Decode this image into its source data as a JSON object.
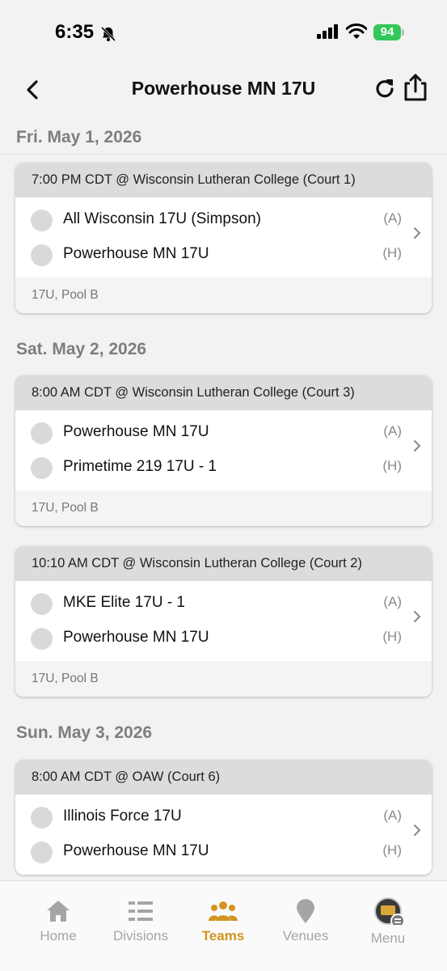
{
  "status": {
    "time": "6:35",
    "battery": "94"
  },
  "nav": {
    "title": "Powerhouse MN 17U"
  },
  "days": [
    {
      "label": "Fri. May 1, 2026",
      "games": [
        {
          "header": "7:00 PM CDT @ Wisconsin Lutheran College (Court 1)",
          "teams": [
            {
              "name": "All Wisconsin 17U (Simpson)",
              "side": "(A)"
            },
            {
              "name": "Powerhouse MN 17U",
              "side": "(H)"
            }
          ],
          "footer": "17U, Pool B"
        }
      ]
    },
    {
      "label": "Sat. May 2, 2026",
      "games": [
        {
          "header": "8:00 AM CDT @ Wisconsin Lutheran College (Court 3)",
          "teams": [
            {
              "name": "Powerhouse MN 17U",
              "side": "(A)"
            },
            {
              "name": "Primetime 219 17U - 1",
              "side": "(H)"
            }
          ],
          "footer": "17U, Pool B"
        },
        {
          "header": "10:10 AM CDT @ Wisconsin Lutheran College (Court 2)",
          "teams": [
            {
              "name": "MKE Elite 17U - 1",
              "side": "(A)"
            },
            {
              "name": "Powerhouse MN 17U",
              "side": "(H)"
            }
          ],
          "footer": "17U, Pool B"
        }
      ]
    },
    {
      "label": "Sun. May 3, 2026",
      "games": [
        {
          "header": "8:00 AM CDT @ OAW (Court 6)",
          "teams": [
            {
              "name": "Illinois Force 17U",
              "side": "(A)"
            },
            {
              "name": "Powerhouse MN 17U",
              "side": "(H)"
            }
          ],
          "footer": ""
        }
      ]
    }
  ],
  "tabs": [
    {
      "label": "Home",
      "icon": "home-icon",
      "active": false
    },
    {
      "label": "Divisions",
      "icon": "divisions-icon",
      "active": false
    },
    {
      "label": "Teams",
      "icon": "teams-icon",
      "active": true
    },
    {
      "label": "Venues",
      "icon": "venues-icon",
      "active": false
    },
    {
      "label": "Menu",
      "icon": "menu-avatar-icon",
      "active": false
    }
  ],
  "colors": {
    "accent": "#d39420",
    "inactive": "#a5a5a5",
    "battery": "#33c759"
  }
}
